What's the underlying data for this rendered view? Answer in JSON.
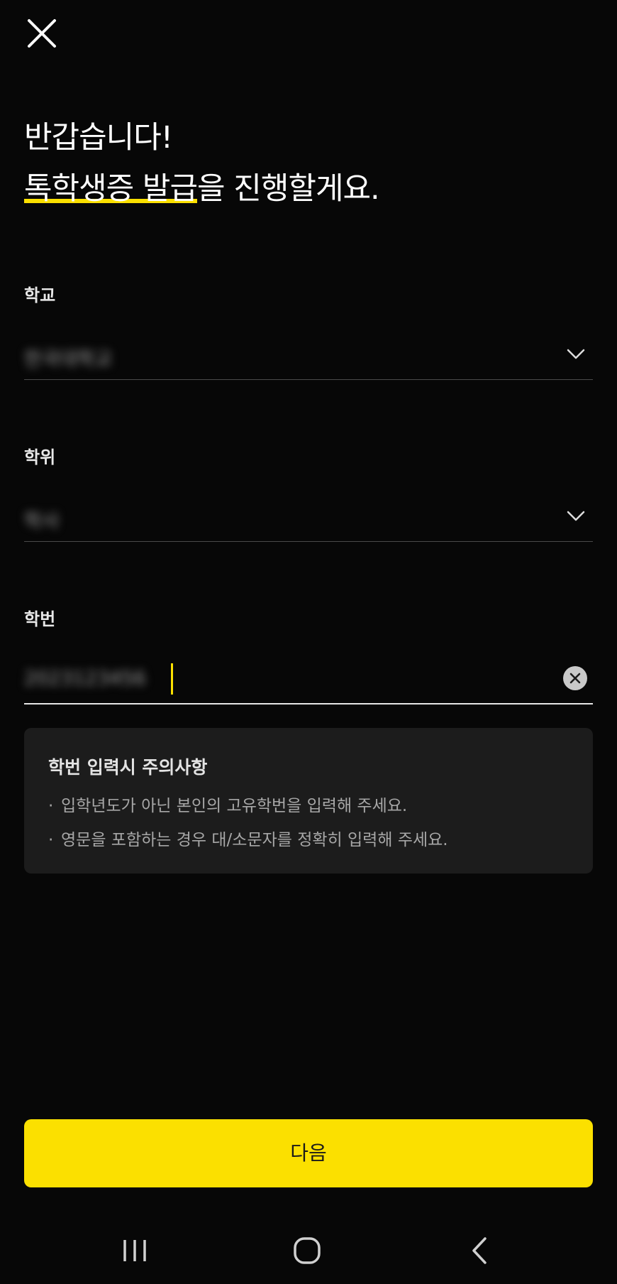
{
  "header": {
    "greeting": "반갑습니다!",
    "headline_highlight": "톡학생증 발급",
    "headline_rest": "을 진행할게요."
  },
  "fields": {
    "school": {
      "label": "학교",
      "value": "한국대학교"
    },
    "degree": {
      "label": "학위",
      "value": "학사"
    },
    "student_id": {
      "label": "학번",
      "value": "2023123456"
    }
  },
  "notice": {
    "title": "학번 입력시 주의사항",
    "items": [
      "입학년도가 아닌 본인의 고유학번을 입력해 주세요.",
      "영문을 포함하는 경우 대/소문자를 정확히 입력해 주세요."
    ]
  },
  "next_button": {
    "label": "다음"
  },
  "colors": {
    "accent": "#fbe000",
    "background": "#070707",
    "panel": "#1c1c1c"
  },
  "icons": {
    "close": "close-icon",
    "chevron": "chevron-down-icon",
    "clear": "clear-icon",
    "nav_recents": "recents-icon",
    "nav_home": "home-icon",
    "nav_back": "back-icon"
  }
}
